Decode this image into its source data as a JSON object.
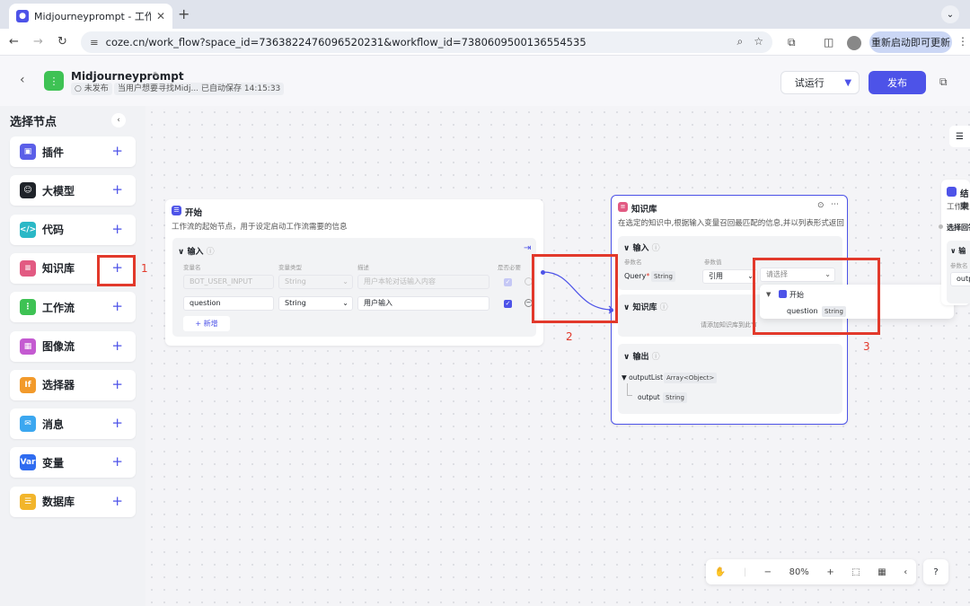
{
  "browser": {
    "tab_title": "Midjourneyprompt - 工作流 - ·",
    "url": "coze.cn/work_flow?space_id=7363822476096520231&workflow_id=7380609500136554535",
    "restart_label": "重新启动即可更新"
  },
  "header": {
    "title": "Midjourneyprompt",
    "status": "未发布",
    "desc": "当用户想要寻找Midj...",
    "autosave": "已自动保存 14:15:33",
    "test_run": "试运行",
    "publish": "发布"
  },
  "sidebar": {
    "title": "选择节点",
    "items": [
      {
        "label": "插件",
        "icon": "plugin-icon",
        "color": "#5b5fe8",
        "glyph": "▣"
      },
      {
        "label": "大模型",
        "icon": "llm-icon",
        "color": "#1f2329",
        "glyph": "☺"
      },
      {
        "label": "代码",
        "icon": "code-icon",
        "color": "#2ab8c6",
        "glyph": "</>"
      },
      {
        "label": "知识库",
        "icon": "knowledge-icon",
        "color": "#e25a82",
        "glyph": "≡"
      },
      {
        "label": "工作流",
        "icon": "workflow-icon",
        "color": "#3ec254",
        "glyph": "⋮"
      },
      {
        "label": "图像流",
        "icon": "imageflow-icon",
        "color": "#c45ad1",
        "glyph": "▦"
      },
      {
        "label": "选择器",
        "icon": "selector-icon",
        "color": "#f29a2b",
        "glyph": "If"
      },
      {
        "label": "消息",
        "icon": "message-icon",
        "color": "#3ba7f0",
        "glyph": "✉"
      },
      {
        "label": "变量",
        "icon": "variable-icon",
        "color": "#2f6cf0",
        "glyph": "Var"
      },
      {
        "label": "数据库",
        "icon": "database-icon",
        "color": "#f2b52b",
        "glyph": "☰"
      }
    ]
  },
  "start_node": {
    "title": "开始",
    "desc": "工作流的起始节点，用于设定启动工作流需要的信息",
    "section": "输入",
    "cols": [
      "变量名",
      "变量类型",
      "描述",
      "是否必要"
    ],
    "rows": [
      {
        "name": "BOT_USER_INPUT",
        "type": "String",
        "desc": "用户本轮对话输入内容"
      },
      {
        "name": "question",
        "type": "String",
        "desc": "用户输入"
      }
    ],
    "add_label": "新增"
  },
  "kb_node": {
    "title": "知识库",
    "desc": "在选定的知识中,根据输入变量召回最匹配的信息,并以列表形式返回",
    "input_section": "输入",
    "cols": [
      "参数名",
      "参数值"
    ],
    "param_name": "Query",
    "param_type": "String",
    "param_mode": "引用",
    "select_placeholder": "请选择",
    "kb_section": "知识库",
    "kb_hint": "请添加知识库到此节",
    "output_section": "输出",
    "output_list": "outputList",
    "output_list_type": "Array<Object>",
    "output_item": "output",
    "output_item_type": "String"
  },
  "dropdown": {
    "group": "开始",
    "item": "question",
    "item_type": "String"
  },
  "end_node": {
    "title": "结束",
    "desc": "工作流的",
    "label": "选择回答",
    "sub": "输",
    "param": "参数名",
    "field": "outp"
  },
  "annotations": [
    "1",
    "2",
    "3"
  ],
  "toolbar": {
    "zoom": "80%"
  }
}
